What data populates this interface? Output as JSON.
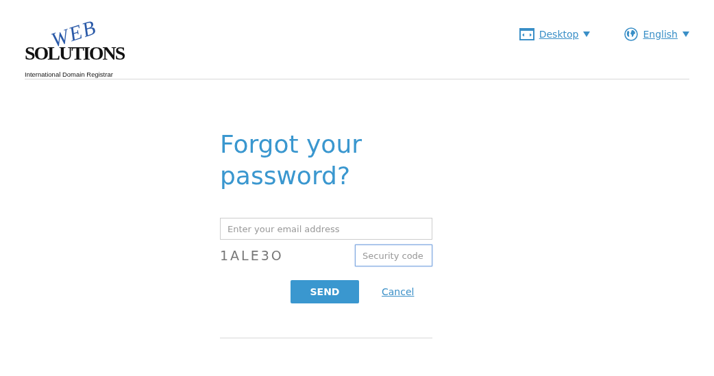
{
  "logo": {
    "accent": "WEB",
    "name": "SOLUTIONS",
    "tagline": "International Domain Registrar"
  },
  "header_links": [
    {
      "label": "Desktop",
      "kind": "display"
    },
    {
      "label": "English",
      "kind": "language"
    }
  ],
  "form": {
    "title": "Forgot your password?",
    "email": {
      "placeholder": "Enter your email address"
    },
    "captcha": "1ALE3O",
    "security_code": {
      "placeholder": "Security code",
      "focused": true
    },
    "send": "SEND",
    "cancel": "Cancel"
  }
}
